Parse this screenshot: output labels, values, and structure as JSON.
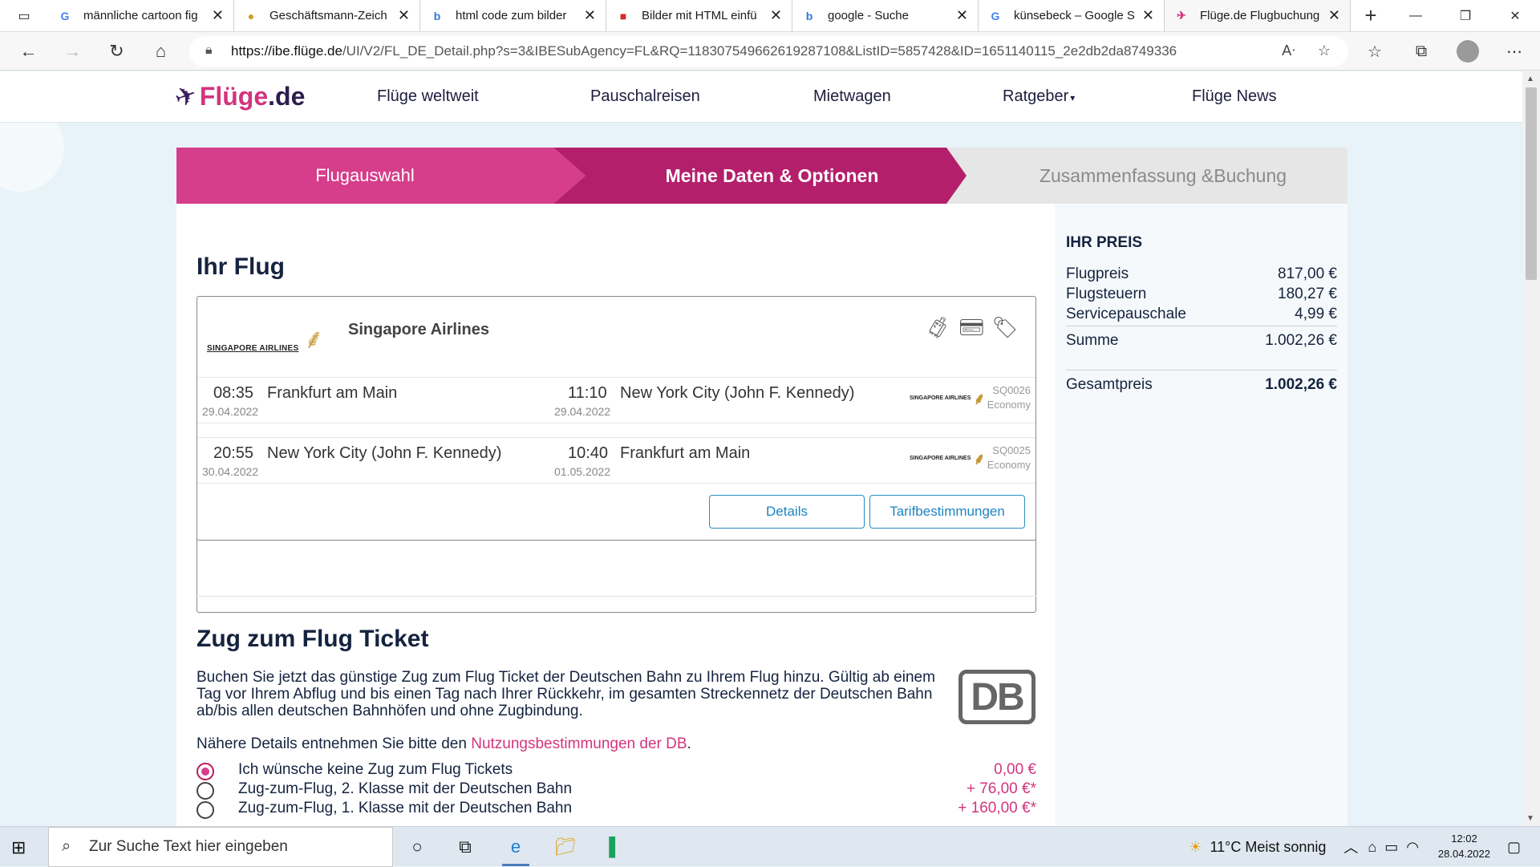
{
  "browser": {
    "tabs": [
      {
        "label": "männliche cartoon fig",
        "favicon": "google-icon"
      },
      {
        "label": "Geschäftsmann-Zeich",
        "favicon": "site-icon"
      },
      {
        "label": "html code zum bilder",
        "favicon": "bing-icon"
      },
      {
        "label": "Bilder mit HTML einfü",
        "favicon": "bookmark-icon"
      },
      {
        "label": "google - Suche",
        "favicon": "bing-icon"
      },
      {
        "label": "künsebeck – Google S",
        "favicon": "google-icon"
      },
      {
        "label": "Flüge.de Flugbuchung",
        "favicon": "fluege-icon"
      }
    ],
    "url_host": "https://ibe.flüge.de",
    "url_path": "/UI/V2/FL_DE_Detail.php?s=3&IBESubAgency=FL&RQ=118307549662619287108&ListID=5857428&ID=1651140115_2e2db2da8749336"
  },
  "site": {
    "logo_brand": "Flüge",
    "logo_tld": ".de",
    "nav": [
      "Flüge weltweit",
      "Pauschalreisen",
      "Mietwagen",
      "Ratgeber",
      "Flüge News"
    ]
  },
  "steps": {
    "step1": "Flugauswahl",
    "step2": "Meine Daten & Optionen",
    "step3": "Zusammenfassung &Buchung"
  },
  "flight": {
    "heading": "Ihr Flug",
    "airline_logo_text": "SINGAPORE AIRLINES",
    "airline": "Singapore Airlines",
    "segments": [
      {
        "dep_time": "08:35",
        "dep_city": "Frankfurt am Main",
        "dep_date": "29.04.2022",
        "arr_time": "11:10",
        "arr_city": "New York City (John F. Kennedy)",
        "arr_date": "29.04.2022",
        "flight_no": "SQ0026",
        "class": "Economy"
      },
      {
        "dep_time": "20:55",
        "dep_city": "New York City (John F. Kennedy)",
        "dep_date": "30.04.2022",
        "arr_time": "10:40",
        "arr_city": "Frankfurt am Main",
        "arr_date": "01.05.2022",
        "flight_no": "SQ0025",
        "class": "Economy"
      }
    ],
    "btn_details": "Details",
    "btn_tarif": "Tarifbestimmungen"
  },
  "zug": {
    "heading": "Zug zum Flug Ticket",
    "text": "Buchen Sie jetzt das günstige Zug zum Flug Ticket der Deutschen Bahn zu Ihrem Flug hinzu. Gültig ab einem Tag vor Ihrem Abflug und bis einen Tag nach Ihrer Rückkehr, im gesamten Streckennetz der Deutschen Bahn ab/bis allen deutschen Bahnhöfen und ohne Zugbindung.",
    "logo_text": "DB",
    "more_prefix": "Nähere Details entnehmen Sie bitte den ",
    "more_link": "Nutzungsbestimmungen der DB",
    "more_suffix": ".",
    "options": [
      {
        "label": "Ich wünsche keine Zug zum Flug Tickets",
        "price": "0,00 €",
        "selected": true
      },
      {
        "label": "Zug-zum-Flug, 2. Klasse mit der Deutschen Bahn",
        "price": "+ 76,00 €*",
        "selected": false
      },
      {
        "label": "Zug-zum-Flug, 1. Klasse mit der Deutschen Bahn",
        "price": "+ 160,00 €*",
        "selected": false
      }
    ]
  },
  "price": {
    "title": "IHR PREIS",
    "rows": [
      {
        "label": "Flugpreis",
        "value": "817,00 €"
      },
      {
        "label": "Flugsteuern",
        "value": "180,27 €"
      },
      {
        "label": "Servicepauschale",
        "value": "4,99 €"
      }
    ],
    "sum_label": "Summe",
    "sum_value": "1.002,26 €",
    "total_label": "Gesamtpreis",
    "total_value": "1.002,26 €"
  },
  "taskbar": {
    "search_placeholder": "Zur Suche Text hier eingeben",
    "weather": "11°C  Meist sonnig",
    "time": "12:02",
    "date": "28.04.2022"
  },
  "colors": {
    "brand_pink": "#d63d8a",
    "brand_dark": "#b41f6c",
    "link_blue": "#1f84c1"
  }
}
